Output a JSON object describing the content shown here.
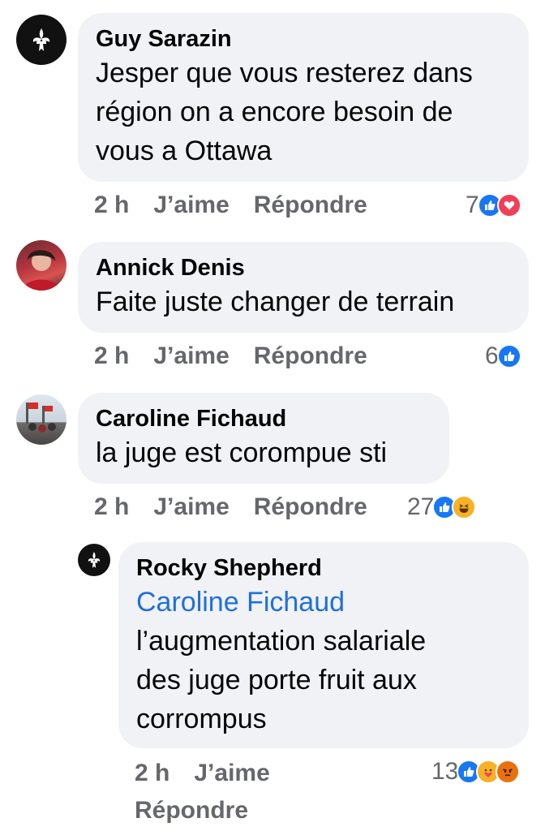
{
  "colors": {
    "like_blue": "#1877f2",
    "love_red": "#f33e58",
    "haha_yellow": "#f7b125",
    "angry_orange": "#e9710f",
    "mention_blue": "#216fdb",
    "bubble_bg": "#f0f2f5",
    "meta_gray": "#65676b"
  },
  "comments": [
    {
      "author": "Guy Sarazin",
      "avatar": "fleur-de-lis-icon",
      "lines": [
        "Jesper que vous resterez dans",
        "région on a encore besoin de",
        "vous a Ottawa"
      ],
      "time": "2 h",
      "like_label": "J’aime",
      "reply_label": "Répondre",
      "reaction_count": "7",
      "reactions": [
        "like-icon",
        "love-icon"
      ]
    },
    {
      "author": "Annick Denis",
      "avatar": "profile-photo",
      "lines": [
        "Faite juste changer de terrain"
      ],
      "time": "2 h",
      "like_label": "J’aime",
      "reply_label": "Répondre",
      "reaction_count": "6",
      "reactions": [
        "like-icon"
      ]
    },
    {
      "author": "Caroline Fichaud",
      "avatar": "profile-photo",
      "lines": [
        "la juge est corompue sti"
      ],
      "time": "2 h",
      "like_label": "J’aime",
      "reply_label": "Répondre",
      "reaction_count": "27",
      "reactions": [
        "like-icon",
        "haha-icon"
      ]
    }
  ],
  "reply": {
    "author": "Rocky Shepherd",
    "avatar": "fleur-de-lis-icon",
    "mention": "Caroline Fichaud",
    "lines": [
      "l’augmentation salariale",
      "des juge porte fruit aux",
      "corrompus"
    ],
    "time": "2 h",
    "like_label": "J’aime",
    "reply_label": "Répondre",
    "reaction_count": "13",
    "reactions": [
      "like-icon",
      "care-icon",
      "angry-icon"
    ]
  }
}
